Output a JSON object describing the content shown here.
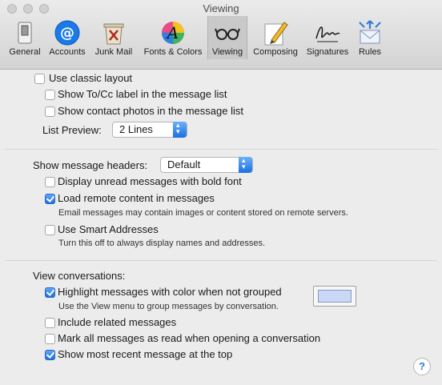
{
  "window": {
    "title": "Viewing"
  },
  "toolbar": {
    "items": [
      {
        "label": "General",
        "icon": "general-switch-icon"
      },
      {
        "label": "Accounts",
        "icon": "at-sign-icon"
      },
      {
        "label": "Junk Mail",
        "icon": "junk-bin-icon"
      },
      {
        "label": "Fonts & Colors",
        "icon": "fonts-colors-icon"
      },
      {
        "label": "Viewing",
        "icon": "glasses-icon",
        "selected": true
      },
      {
        "label": "Composing",
        "icon": "pencil-icon"
      },
      {
        "label": "Signatures",
        "icon": "signature-icon"
      },
      {
        "label": "Rules",
        "icon": "rules-envelope-icon"
      }
    ]
  },
  "layout_section": {
    "classic_layout": {
      "label": "Use classic layout",
      "checked": false
    },
    "show_tocc": {
      "label": "Show To/Cc label in the message list",
      "checked": false
    },
    "show_photos": {
      "label": "Show contact photos in the message list",
      "checked": false
    },
    "list_preview": {
      "label": "List Preview:",
      "value": "2 Lines"
    }
  },
  "headers_section": {
    "show_headers": {
      "label": "Show message headers:",
      "value": "Default"
    },
    "bold_unread": {
      "label": "Display unread messages with bold font",
      "checked": false
    },
    "remote_content": {
      "label": "Load remote content in messages",
      "checked": true,
      "note": "Email messages may contain images or content stored on remote servers."
    },
    "smart_addresses": {
      "label": "Use Smart Addresses",
      "checked": false,
      "note": "Turn this off to always display names and addresses."
    }
  },
  "conversations_section": {
    "heading": "View conversations:",
    "highlight": {
      "label": "Highlight messages with color when not grouped",
      "checked": true,
      "note": "Use the View menu to group messages by conversation.",
      "color": "#c8d8f6"
    },
    "include_related": {
      "label": "Include related messages",
      "checked": false
    },
    "mark_read": {
      "label": "Mark all messages as read when opening a conversation",
      "checked": false
    },
    "recent_top": {
      "label": "Show most recent message at the top",
      "checked": true
    }
  },
  "help": {
    "label": "?"
  }
}
